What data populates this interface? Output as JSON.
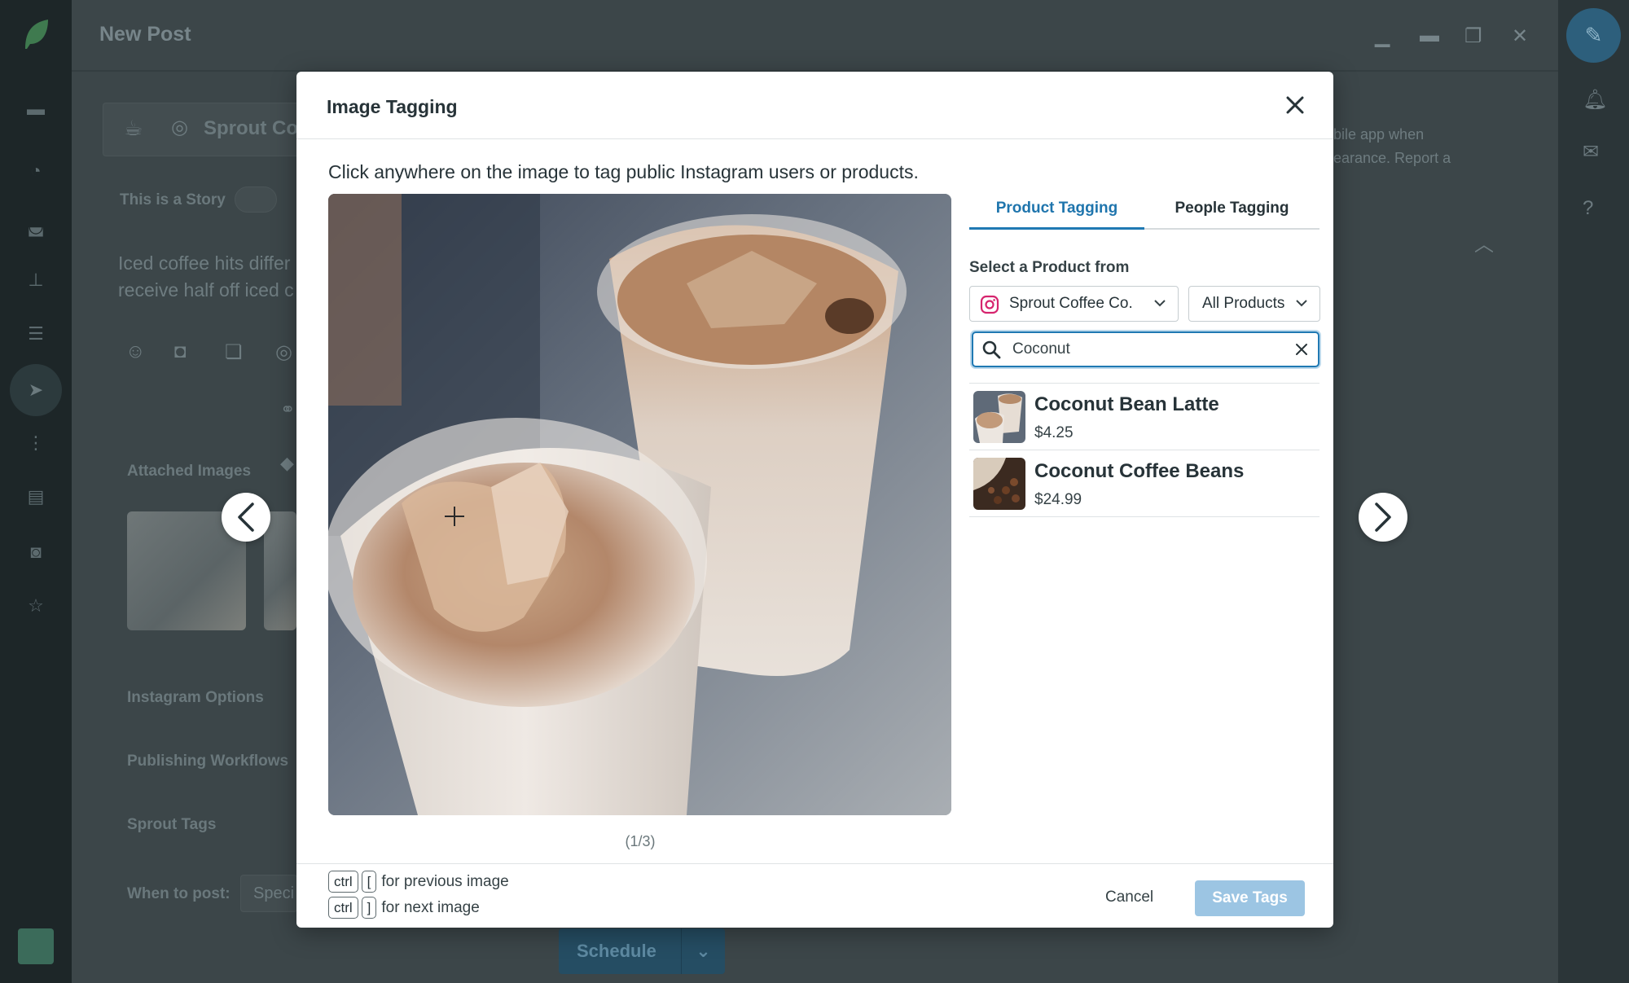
{
  "app": {
    "title": "New Post",
    "account_name": "Sprout Co",
    "story_toggle_label": "This is a Story",
    "message_preview": [
      "Iced coffee hits differ",
      "receive half off iced c"
    ],
    "sections": [
      "Attached Images",
      "Instagram Options",
      "Publishing Workflows",
      "Sprout Tags"
    ],
    "when_to_post_label": "When to post:",
    "when_to_post_value": "Speci",
    "right_note": [
      "bile app when",
      "earance. Report a"
    ],
    "schedule_label": "Schedule"
  },
  "modal": {
    "title": "Image Tagging",
    "instruction": "Click anywhere on the image to tag public Instagram users or products.",
    "counter": "(1/3)",
    "tabs": {
      "product": "Product Tagging",
      "people": "People Tagging"
    },
    "select_label": "Select a Product from",
    "account_dropdown": "Sprout Coffee Co.",
    "filter_dropdown": "All Products",
    "search": {
      "value": "Coconut",
      "placeholder": "Coconut"
    },
    "results": [
      {
        "name": "Coconut Bean Latte",
        "price": "$4.25"
      },
      {
        "name": "Coconut Coffee Beans",
        "price": "$24.99"
      }
    ],
    "shortcuts": [
      {
        "key1": "ctrl",
        "key2": "[",
        "desc": "for previous image"
      },
      {
        "key1": "ctrl",
        "key2": "]",
        "desc": "for next image"
      }
    ],
    "cancel_label": "Cancel",
    "save_label": "Save Tags"
  },
  "colors": {
    "accent": "#2079b3",
    "save_disabled": "#9cc5e3"
  }
}
